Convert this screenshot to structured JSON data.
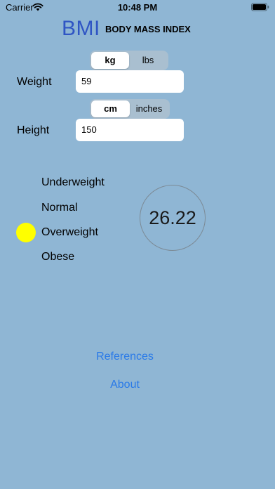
{
  "status_bar": {
    "carrier": "Carrier",
    "time": "10:48 PM",
    "wifi_icon": "wifi-icon",
    "battery_icon": "battery-icon"
  },
  "header": {
    "logo": "BMI",
    "subtitle": "BODY MASS INDEX",
    "logo_color": "#2f55c4"
  },
  "weight": {
    "label": "Weight",
    "value": "59",
    "units": [
      {
        "label": "kg",
        "selected": true
      },
      {
        "label": "lbs",
        "selected": false
      }
    ]
  },
  "height": {
    "label": "Height",
    "value": "150",
    "units": [
      {
        "label": "cm",
        "selected": true
      },
      {
        "label": "inches",
        "selected": false
      }
    ]
  },
  "categories": [
    {
      "label": "Underweight",
      "active": false
    },
    {
      "label": "Normal",
      "active": false
    },
    {
      "label": "Overweight",
      "active": true
    },
    {
      "label": "Obese",
      "active": false
    }
  ],
  "result": {
    "bmi": "26.22",
    "indicator_color": "#ffff00"
  },
  "links": {
    "references": "References",
    "about": "About",
    "link_color": "#2a7ae8"
  },
  "colors": {
    "background": "#8fb6d4"
  }
}
